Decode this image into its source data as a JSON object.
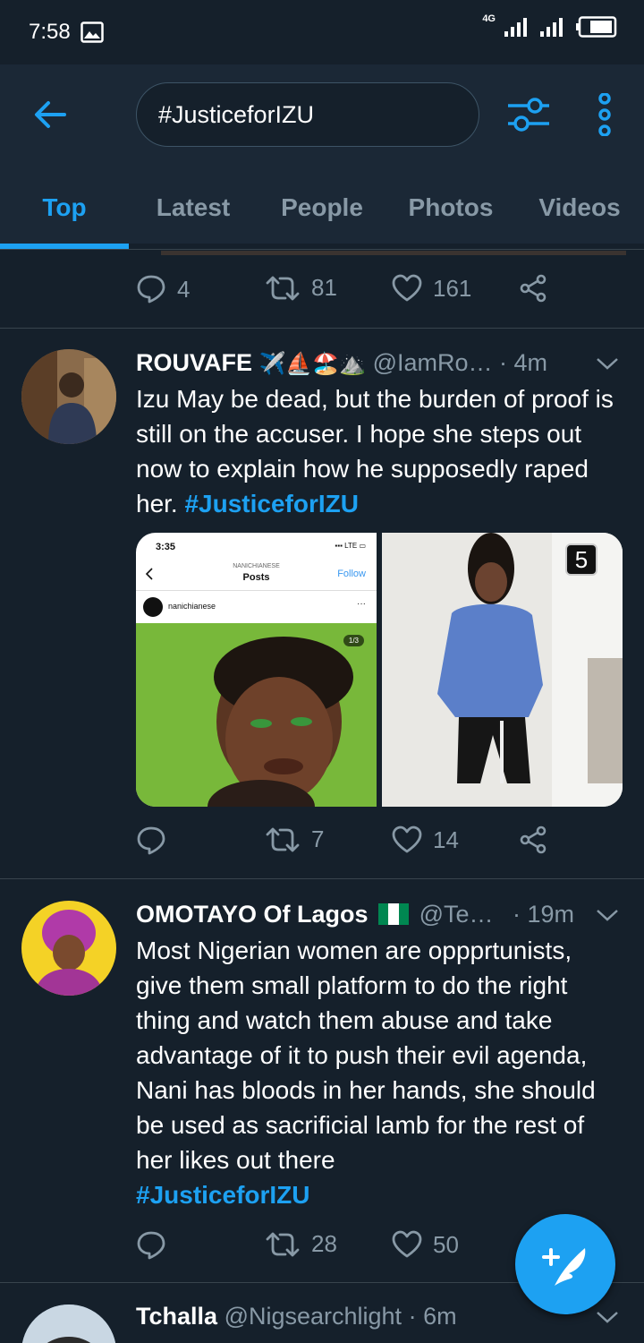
{
  "status": {
    "time": "7:58",
    "network": "4G"
  },
  "search": {
    "query": "#JusticeforIZU"
  },
  "tabs": [
    {
      "label": "Top"
    },
    {
      "label": "Latest"
    },
    {
      "label": "People"
    },
    {
      "label": "Photos"
    },
    {
      "label": "Videos"
    }
  ],
  "prev_tweet": {
    "replies": "4",
    "retweets": "81",
    "likes": "161"
  },
  "tweets": [
    {
      "name": "ROUVAFE",
      "emoji": "✈️⛵🏖️⛰️",
      "handle": "@IamRo…",
      "time": "· 4m",
      "text": "Izu May be dead, but the burden of proof is still on the accuser. I hope she steps out now to explain how he supposedly raped her. ",
      "hashtag": "#JusticeforIZU",
      "media": {
        "shot_time": "3:35",
        "shot_account_upper": "NANICHIANESE",
        "shot_title": "Posts",
        "shot_follow": "Follow",
        "shot_username": "nanichianese",
        "shot_page": "1/3",
        "count": "5"
      },
      "replies": "",
      "retweets": "7",
      "likes": "14"
    },
    {
      "name": "OMOTAYO Of Lagos",
      "handle": "@Te…",
      "time": "· 19m",
      "text": "Most Nigerian women are oppprtunists, give them small platform  to do the right thing and watch them abuse and take advantage of it to push their evil agenda, Nani has bloods in her hands, she should be used as sacrificial lamb for the rest of her likes out there",
      "hashtag": "#JusticeforIZU",
      "replies": "",
      "retweets": "28",
      "likes": "50"
    },
    {
      "name": "Tchalla",
      "handle": "@Nigsearchlight",
      "time": "· 6m"
    }
  ],
  "colors": {
    "accent": "#1da1f2",
    "background": "#15202b",
    "header": "#1b2836",
    "muted": "#8899a6"
  }
}
